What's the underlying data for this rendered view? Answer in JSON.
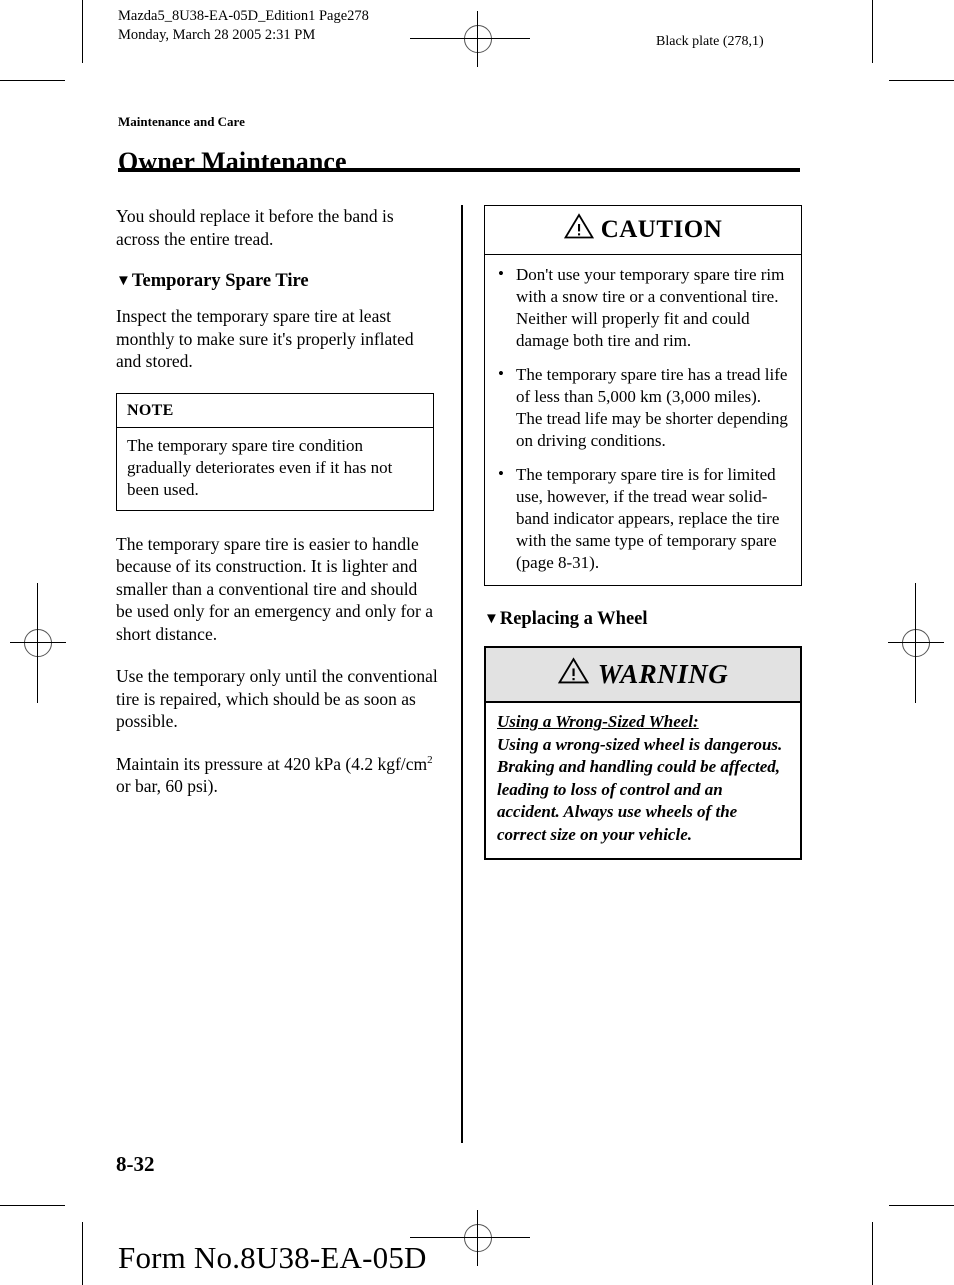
{
  "print_header": {
    "job_info": "Mazda5_8U38-EA-05D_Edition1 Page278\nMonday, March 28 2005 2:31 PM",
    "plate_info": "Black plate (278,1)"
  },
  "header": {
    "kicker": "Maintenance and Care",
    "title": "Owner Maintenance"
  },
  "left_column": {
    "intro_paragraph": "You should replace it before the band is across the entire tread.",
    "subheading": {
      "marker": "▼",
      "text": "Temporary Spare Tire"
    },
    "paragraph_inspect": "Inspect the temporary spare tire at least monthly to make sure it's properly inflated and stored.",
    "note_box": {
      "heading": "NOTE",
      "body": "The temporary spare tire condition gradually deteriorates even if it has not been used."
    },
    "paragraph_handle": "The temporary spare tire is easier to handle because of its construction. It is lighter and smaller than a conventional tire and should be used only for an emergency and only for a short distance.",
    "paragraph_use": "Use the temporary only until the conventional tire is repaired, which should be as soon as possible.",
    "paragraph_pressure_a": "Maintain its pressure at 420 kPa (4.2 kgf/",
    "paragraph_pressure_b": "cm",
    "paragraph_pressure_sup": "2",
    "paragraph_pressure_c": " or bar, 60 psi)."
  },
  "right_column": {
    "caution_box": {
      "icon": "warning-triangle-icon",
      "heading": "CAUTION",
      "bullet_char": "•",
      "items": [
        "Don't use your temporary spare tire rim with a snow tire or a conventional tire. Neither will properly fit and could damage both tire and rim.",
        "The temporary spare tire has a tread life of less than 5,000 km (3,000 miles). The tread life may be shorter depending on driving conditions.",
        "The temporary spare tire is for limited use, however, if the tread wear solid-band indicator appears, replace the tire with the same type of temporary spare (page 8-31)."
      ]
    },
    "subheading": {
      "marker": "▼",
      "text": "Replacing a Wheel"
    },
    "warning_box": {
      "icon": "warning-triangle-icon",
      "heading": "WARNING",
      "lead": "Using a Wrong-Sized Wheel:",
      "body": "Using a wrong-sized wheel is dangerous. Braking and handling could be affected, leading to loss of control and an accident. Always use wheels of the correct size on your vehicle."
    }
  },
  "footer": {
    "page_number": "8-32",
    "form_number": "Form No.8U38-EA-05D"
  },
  "colors": {
    "text": "#000000",
    "page_background": "#ffffff",
    "warning_header_background": "#e2e2e2",
    "rule": "#000000"
  }
}
